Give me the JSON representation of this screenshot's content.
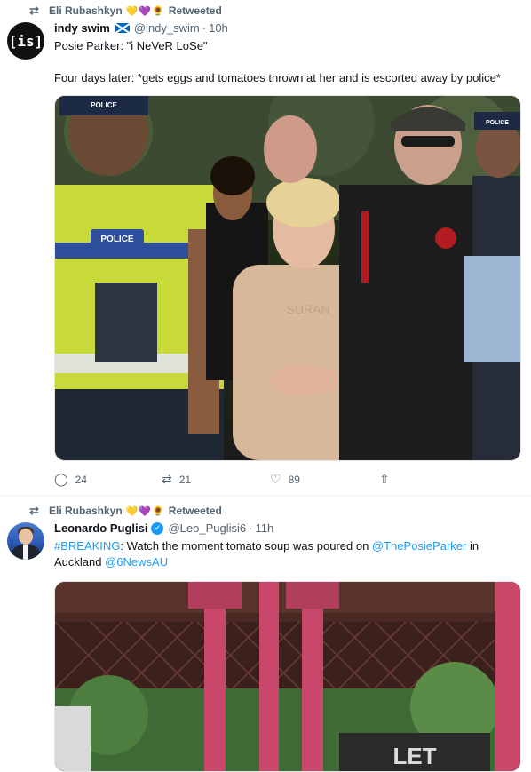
{
  "tweets": [
    {
      "retweeted_by": "Eli Rubashkyn",
      "retweet_label": "Retweeted",
      "retweet_emojis": "💛💜🌻",
      "avatar_text": "[is]",
      "name": "indy swim",
      "handle": "@indy_swim",
      "time": "10h",
      "text": "Posie Parker: \"i NeVeR LoSe\"\n\nFour days later: *gets eggs and tomatoes thrown at her and is escorted away by police*",
      "reply_count": "24",
      "retweet_count": "21",
      "like_count": "89",
      "photo_labels": {
        "cap": "POLICE",
        "vest": "POLICE",
        "shirt": "SURAN",
        "cap2": "POLICE"
      }
    },
    {
      "retweeted_by": "Eli Rubashkyn",
      "retweet_label": "Retweeted",
      "retweet_emojis": "💛💜🌻",
      "name": "Leonardo Puglisi",
      "handle": "@Leo_Puglisi6",
      "time": "11h",
      "text_parts": [
        "#BREAKING",
        ": Watch the moment tomato soup was poured on ",
        "@ThePosieParker",
        " in Auckland ",
        "@6NewsAU"
      ],
      "photo_sign": "LET"
    }
  ],
  "icons": {
    "retweet": "retweet-icon",
    "reply": "reply-icon",
    "like": "heart-icon",
    "share": "share-icon",
    "verified": "verified-badge-icon",
    "flag": "scotland-flag-icon"
  },
  "colors": {
    "accent": "#1d9bf0",
    "secondary_text": "#536471",
    "primary_text": "#0f1419"
  }
}
